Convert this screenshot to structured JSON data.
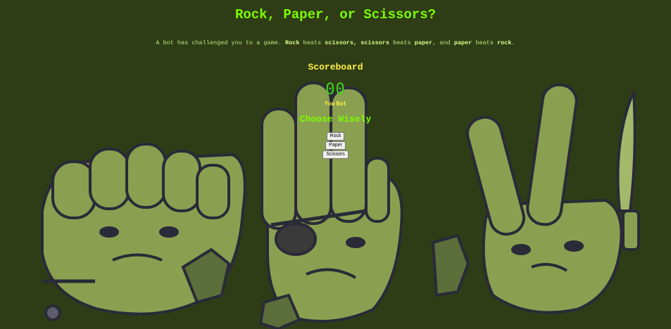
{
  "page": {
    "title": "Rock, Paper, or Scissors?",
    "intro": {
      "t1": "A bot has challenged you to a game. ",
      "b1": "Rock",
      "t2": " beats ",
      "b2": "scissors, scissors",
      "t3": " beats ",
      "b3": "paper",
      "t4": ", and ",
      "b4": "paper",
      "t5": " beats ",
      "b5": "rock",
      "t6": "."
    }
  },
  "scoreboard": {
    "heading": "Scoreboard",
    "you_score": "0",
    "bot_score": "0",
    "you_label": "You",
    "bot_label": "Bot"
  },
  "choose": {
    "heading": "Choose Wisely",
    "rock_label": "Rock",
    "paper_label": "Paper",
    "scissors_label": "Scissors"
  },
  "background": {
    "description_icons": [
      "fist-hand-character",
      "open-hand-character",
      "peace-hand-character"
    ],
    "skin_color": "#8aa050",
    "outline_color": "#2a2a38",
    "bg_color": "#2f3d16"
  }
}
